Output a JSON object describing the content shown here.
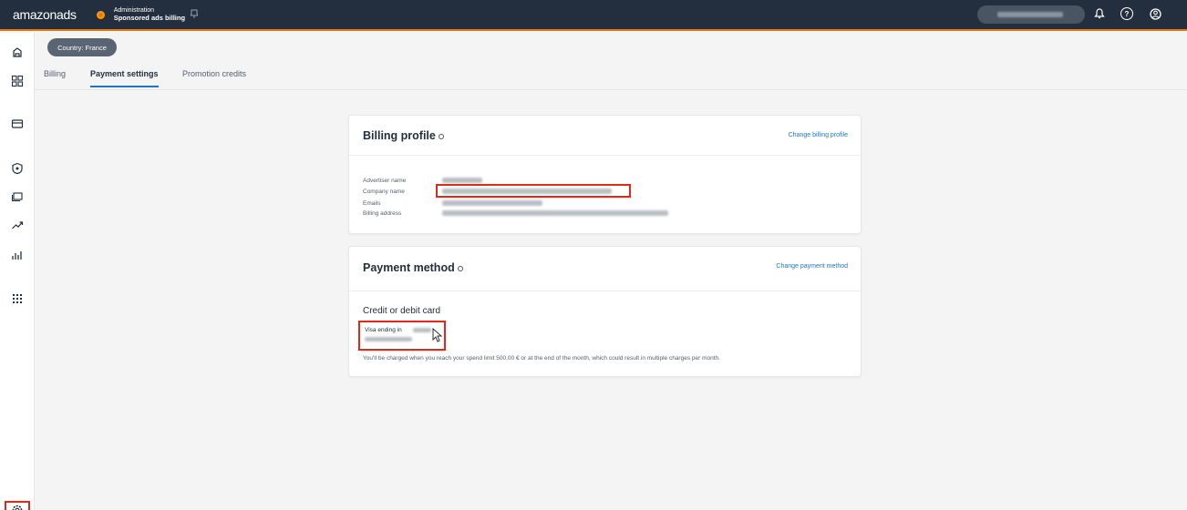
{
  "topbar": {
    "logo_main": "amazon",
    "logo_sub": "ads",
    "crumb_section": "Administration",
    "crumb_page": "Sponsored ads billing",
    "icons": [
      "bell-icon",
      "help-icon",
      "user-icon"
    ]
  },
  "rail": {
    "icons": [
      "campaigns-icon",
      "dashboard-icon",
      "billing-icon",
      "brand-icon",
      "media-icon",
      "growth-icon",
      "reports-icon",
      "apps-icon",
      "settings-icon"
    ]
  },
  "country_pill": "Country: France",
  "tabs": [
    {
      "label": "Billing",
      "active": false
    },
    {
      "label": "Payment settings",
      "active": true
    },
    {
      "label": "Promotion credits",
      "active": false
    }
  ],
  "billing_profile": {
    "title": "Billing profile",
    "change_link": "Change billing profile",
    "fields": {
      "advertiser_name": "Advertiser name",
      "company_name": "Company name",
      "emails": "Emails",
      "billing_address": "Billing address"
    }
  },
  "payment_method": {
    "title": "Payment method",
    "change_link": "Change payment method",
    "card_heading": "Credit or debit card",
    "visa_label": "Visa ending in",
    "charge_note": "You'll be charged when you reach your spend limit 500,00 € or at the end of the month, which could result in multiple charges per month."
  },
  "colors": {
    "topbar_bg": "#232f3e",
    "accent_orange": "#e47911",
    "link_blue": "#1f74c7",
    "highlight_red": "#e3271b"
  }
}
